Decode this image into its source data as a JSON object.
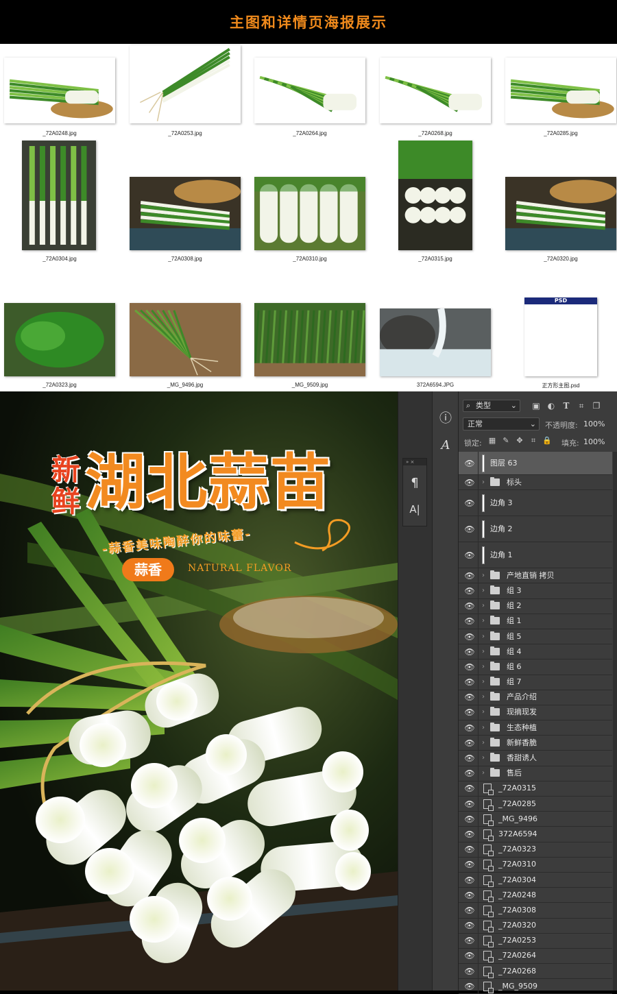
{
  "banner": {
    "title": "主图和详情页海报展示"
  },
  "browser": {
    "files": [
      {
        "label": "_72A0248.jpg",
        "type": "basket"
      },
      {
        "label": "_72A0253.jpg",
        "type": "roots"
      },
      {
        "label": "_72A0264.jpg",
        "type": "bunch"
      },
      {
        "label": "_72A0268.jpg",
        "type": "bunch"
      },
      {
        "label": "_72A0285.jpg",
        "type": "basket"
      },
      {
        "label": "_72A0304.jpg",
        "type": "tall"
      },
      {
        "label": "_72A0308.jpg",
        "type": "table"
      },
      {
        "label": "_72A0310.jpg",
        "type": "closeup"
      },
      {
        "label": "_72A0315.jpg",
        "type": "tallwhite"
      },
      {
        "label": "_72A0320.jpg",
        "type": "table"
      },
      {
        "label": "_72A0323.jpg",
        "type": "leaves"
      },
      {
        "label": "_MG_9496.jpg",
        "type": "soil"
      },
      {
        "label": "_MG_9509.jpg",
        "type": "field"
      },
      {
        "label": "372A6594.JPG",
        "type": "water"
      },
      {
        "label": "正方形主图.psd",
        "type": "psd",
        "badge": "PSD"
      }
    ]
  },
  "poster": {
    "fresh": "新鲜",
    "title": "湖北蒜苗",
    "slogan": "-蒜香美味陶醉你的味蕾-",
    "badge": "蒜香",
    "natural": "NATURAL FLAVOR"
  },
  "photoshop": {
    "kind_label": "类型",
    "blend_mode": "正常",
    "opacity_label": "不透明度:",
    "opacity_value": "100%",
    "lock_label": "锁定:",
    "fill_label": "填充:",
    "fill_value": "100%",
    "layers": [
      {
        "name": "图层 63",
        "kind": "pixel",
        "selected": true
      },
      {
        "name": "标头",
        "kind": "group"
      },
      {
        "name": "边角 3",
        "kind": "text"
      },
      {
        "name": "边角 2",
        "kind": "text"
      },
      {
        "name": "边角 1",
        "kind": "text"
      },
      {
        "name": "产地直销 拷贝",
        "kind": "group"
      },
      {
        "name": "组 3",
        "kind": "group"
      },
      {
        "name": "组 2",
        "kind": "group"
      },
      {
        "name": "组 1",
        "kind": "group"
      },
      {
        "name": "组 5",
        "kind": "group"
      },
      {
        "name": "组 4",
        "kind": "group"
      },
      {
        "name": "组 6",
        "kind": "group"
      },
      {
        "name": "组 7",
        "kind": "group"
      },
      {
        "name": "产品介绍",
        "kind": "group"
      },
      {
        "name": "现摘现发",
        "kind": "group"
      },
      {
        "name": "生态种植",
        "kind": "group"
      },
      {
        "name": "新鲜香脆",
        "kind": "group"
      },
      {
        "name": "香甜诱人",
        "kind": "group"
      },
      {
        "name": "售后",
        "kind": "group"
      },
      {
        "name": "_72A0315",
        "kind": "smart"
      },
      {
        "name": "_72A0285",
        "kind": "smart"
      },
      {
        "name": "_MG_9496",
        "kind": "smart"
      },
      {
        "name": "372A6594",
        "kind": "smart"
      },
      {
        "name": "_72A0323",
        "kind": "smart"
      },
      {
        "name": "_72A0310",
        "kind": "smart"
      },
      {
        "name": "_72A0304",
        "kind": "smart"
      },
      {
        "name": "_72A0248",
        "kind": "smart"
      },
      {
        "name": "_72A0308",
        "kind": "smart"
      },
      {
        "name": "_72A0320",
        "kind": "smart"
      },
      {
        "name": "_72A0253",
        "kind": "smart"
      },
      {
        "name": "_72A0264",
        "kind": "smart"
      },
      {
        "name": "_72A0268",
        "kind": "smart"
      },
      {
        "name": "_MG_9509",
        "kind": "smart"
      }
    ]
  }
}
